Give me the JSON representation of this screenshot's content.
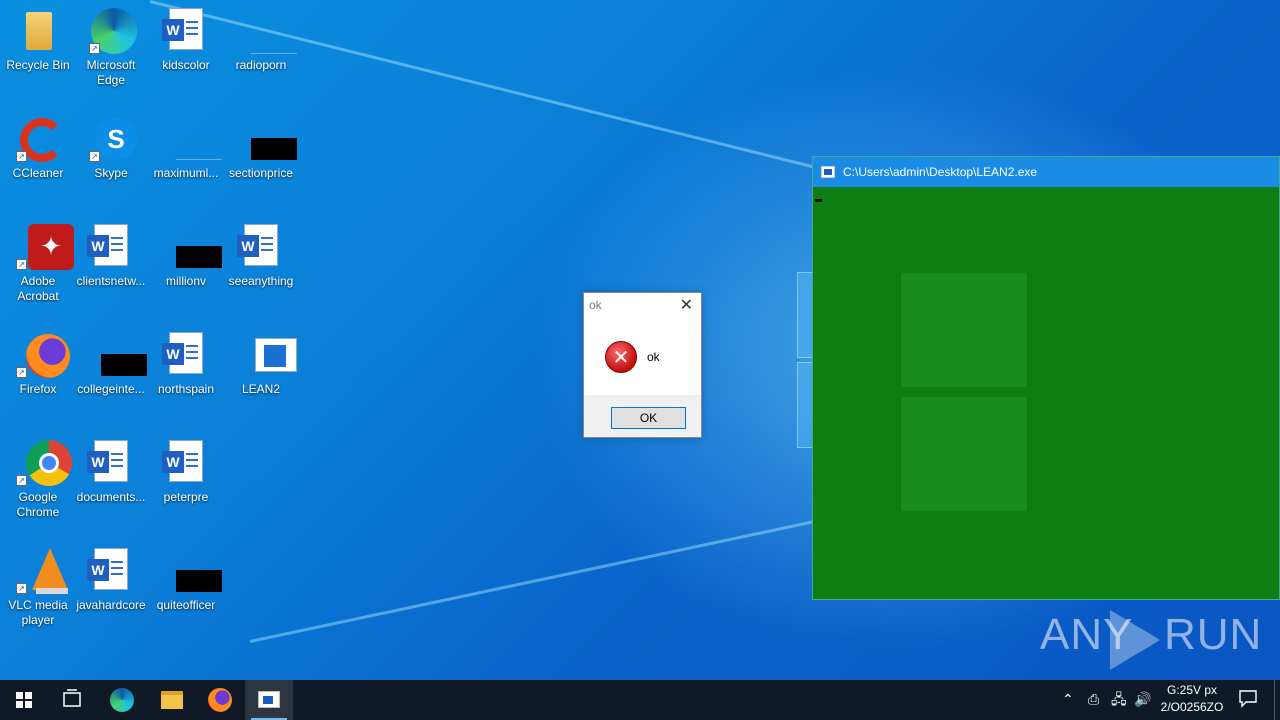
{
  "desktop": {
    "icons": [
      {
        "label": "Recycle Bin"
      },
      {
        "label": "Microsoft Edge"
      },
      {
        "label": "kidscolor"
      },
      {
        "label": "radioporn"
      },
      {
        "label": "CCleaner"
      },
      {
        "label": "Skype"
      },
      {
        "label": "maximuml..."
      },
      {
        "label": "sectionprice"
      },
      {
        "label": "Adobe Acrobat"
      },
      {
        "label": "clientsnetw..."
      },
      {
        "label": "millionv"
      },
      {
        "label": "seeanything"
      },
      {
        "label": "Firefox"
      },
      {
        "label": "collegeinte..."
      },
      {
        "label": "northspain"
      },
      {
        "label": "LEAN2"
      },
      {
        "label": "Google Chrome"
      },
      {
        "label": "documents..."
      },
      {
        "label": "peterpre"
      },
      {
        "label": "VLC media player"
      },
      {
        "label": "javahardcore"
      },
      {
        "label": "quiteofficer"
      }
    ]
  },
  "console": {
    "title": "C:\\Users\\admin\\Desktop\\LEAN2.exe",
    "color": "#0e7d12"
  },
  "msgbox": {
    "title": "ok",
    "message": "ok",
    "button": "OK",
    "close_glyph": "✕",
    "icon": "error-icon",
    "icon_glyph": "✕"
  },
  "watermark": {
    "left": "ANY",
    "right": "RUN"
  },
  "taskbar": {
    "items": [
      "start-icon",
      "task-view-icon",
      "edge-icon",
      "file-explorer-icon",
      "firefox-icon",
      "lean2-console-icon"
    ],
    "clock": {
      "time": "G:25V px",
      "date": "2/O0256ZO"
    }
  },
  "colors": {
    "accent": "#1a8ce6",
    "taskbar": "#101a26",
    "error": "#c10f0f"
  }
}
